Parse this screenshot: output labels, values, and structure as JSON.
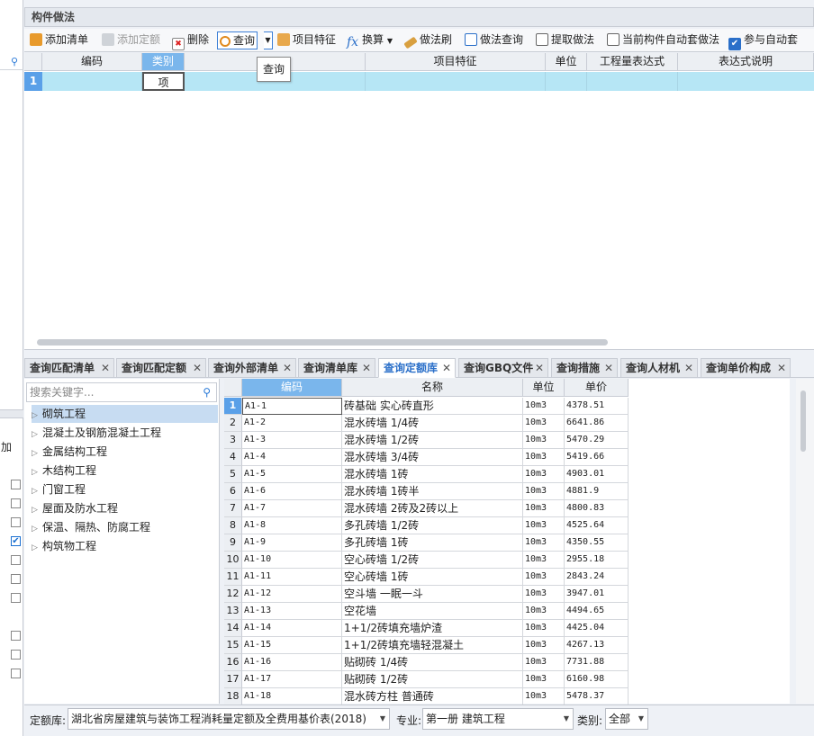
{
  "panel": {
    "title": "构件做法"
  },
  "toolbar": {
    "add_list": "添加清单",
    "add_quota": "添加定额",
    "delete": "删除",
    "query": "查询",
    "item_feature": "项目特征",
    "convert": "换算",
    "format_brush": "做法刷",
    "method_query": "做法查询",
    "extract_method": "提取做法",
    "auto_method": "当前构件自动套做法",
    "auto_participate": "参与自动套",
    "auto_checked": true
  },
  "tooltip": "查询",
  "top_grid": {
    "headers": [
      "编码",
      "类别",
      "项目特征",
      "单位",
      "工程量表达式",
      "表达式说明"
    ],
    "row": {
      "num": "1",
      "category": "项"
    }
  },
  "tabs": [
    {
      "label": "查询匹配清单"
    },
    {
      "label": "查询匹配定额"
    },
    {
      "label": "查询外部清单"
    },
    {
      "label": "查询清单库"
    },
    {
      "label": "查询定额库",
      "active": true
    },
    {
      "label": "查询GBQ文件"
    },
    {
      "label": "查询措施"
    },
    {
      "label": "查询人材机"
    },
    {
      "label": "查询单价构成"
    }
  ],
  "tree": {
    "search_placeholder": "搜索关键字...",
    "items": [
      {
        "label": "砌筑工程",
        "selected": true
      },
      {
        "label": "混凝土及钢筋混凝土工程"
      },
      {
        "label": "金属结构工程"
      },
      {
        "label": "木结构工程"
      },
      {
        "label": "门窗工程"
      },
      {
        "label": "屋面及防水工程"
      },
      {
        "label": "保温、隔热、防腐工程"
      },
      {
        "label": "构筑物工程"
      }
    ]
  },
  "quota_grid": {
    "headers": [
      "编码",
      "名称",
      "单位",
      "单价"
    ],
    "rows": [
      {
        "num": "1",
        "code": "A1-1",
        "name": "砖基础 实心砖直形",
        "unit": "10m3",
        "price": "4378.51"
      },
      {
        "num": "2",
        "code": "A1-2",
        "name": "混水砖墙 1/4砖",
        "unit": "10m3",
        "price": "6641.86"
      },
      {
        "num": "3",
        "code": "A1-3",
        "name": "混水砖墙 1/2砖",
        "unit": "10m3",
        "price": "5470.29"
      },
      {
        "num": "4",
        "code": "A1-4",
        "name": "混水砖墙 3/4砖",
        "unit": "10m3",
        "price": "5419.66"
      },
      {
        "num": "5",
        "code": "A1-5",
        "name": "混水砖墙 1砖",
        "unit": "10m3",
        "price": "4903.01"
      },
      {
        "num": "6",
        "code": "A1-6",
        "name": "混水砖墙 1砖半",
        "unit": "10m3",
        "price": "4881.9"
      },
      {
        "num": "7",
        "code": "A1-7",
        "name": "混水砖墙 2砖及2砖以上",
        "unit": "10m3",
        "price": "4800.83"
      },
      {
        "num": "8",
        "code": "A1-8",
        "name": "多孔砖墙 1/2砖",
        "unit": "10m3",
        "price": "4525.64"
      },
      {
        "num": "9",
        "code": "A1-9",
        "name": "多孔砖墙 1砖",
        "unit": "10m3",
        "price": "4350.55"
      },
      {
        "num": "10",
        "code": "A1-10",
        "name": "空心砖墙 1/2砖",
        "unit": "10m3",
        "price": "2955.18"
      },
      {
        "num": "11",
        "code": "A1-11",
        "name": "空心砖墙 1砖",
        "unit": "10m3",
        "price": "2843.24"
      },
      {
        "num": "12",
        "code": "A1-12",
        "name": "空斗墙 一眠一斗",
        "unit": "10m3",
        "price": "3947.01"
      },
      {
        "num": "13",
        "code": "A1-13",
        "name": "空花墙",
        "unit": "10m3",
        "price": "4494.65"
      },
      {
        "num": "14",
        "code": "A1-14",
        "name": "1+1/2砖填充墙炉渣",
        "unit": "10m3",
        "price": "4425.04"
      },
      {
        "num": "15",
        "code": "A1-15",
        "name": "1+1/2砖填充墙轻混凝土",
        "unit": "10m3",
        "price": "4267.13"
      },
      {
        "num": "16",
        "code": "A1-16",
        "name": "贴砌砖 1/4砖",
        "unit": "10m3",
        "price": "7731.88"
      },
      {
        "num": "17",
        "code": "A1-17",
        "name": "贴砌砖 1/2砖",
        "unit": "10m3",
        "price": "6160.98"
      },
      {
        "num": "18",
        "code": "A1-18",
        "name": "混水砖方柱 普通砖",
        "unit": "10m3",
        "price": "5478.37"
      }
    ]
  },
  "bottom": {
    "quota_lib_label": "定额库:",
    "quota_lib_value": "湖北省房屋建筑与装饰工程消耗量定额及全费用基价表(2018)",
    "major_label": "专业:",
    "major_value": "第一册 建筑工程",
    "category_label": "类别:",
    "category_value": "全部"
  },
  "left_strip": {
    "add_label": "加"
  }
}
